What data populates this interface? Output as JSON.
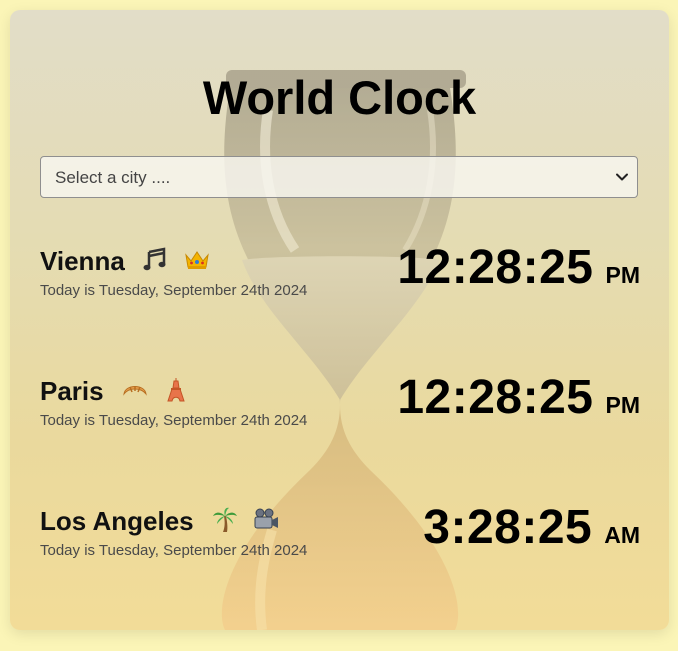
{
  "app": {
    "title": "World Clock"
  },
  "city_select": {
    "placeholder": "Select a city ...."
  },
  "cities": [
    {
      "name": "Vienna",
      "icons": [
        "music-notes-icon",
        "crown-icon"
      ],
      "date": "Today is Tuesday, September 24th 2024",
      "time": "12:28:25",
      "ampm": "PM"
    },
    {
      "name": "Paris",
      "icons": [
        "croissant-icon",
        "eiffel-tower-icon"
      ],
      "date": "Today is Tuesday, September 24th 2024",
      "time": "12:28:25",
      "ampm": "PM"
    },
    {
      "name": "Los Angeles",
      "icons": [
        "palm-tree-icon",
        "movie-camera-icon"
      ],
      "date": "Today is Tuesday, September 24th 2024",
      "time": "3:28:25",
      "ampm": "AM"
    }
  ],
  "colors": {
    "page_background": "#fbf5b7",
    "card_top": "#e2ddc8",
    "card_bottom": "#f2dc98",
    "text": "#000000",
    "date_text": "#4a4a4a"
  }
}
